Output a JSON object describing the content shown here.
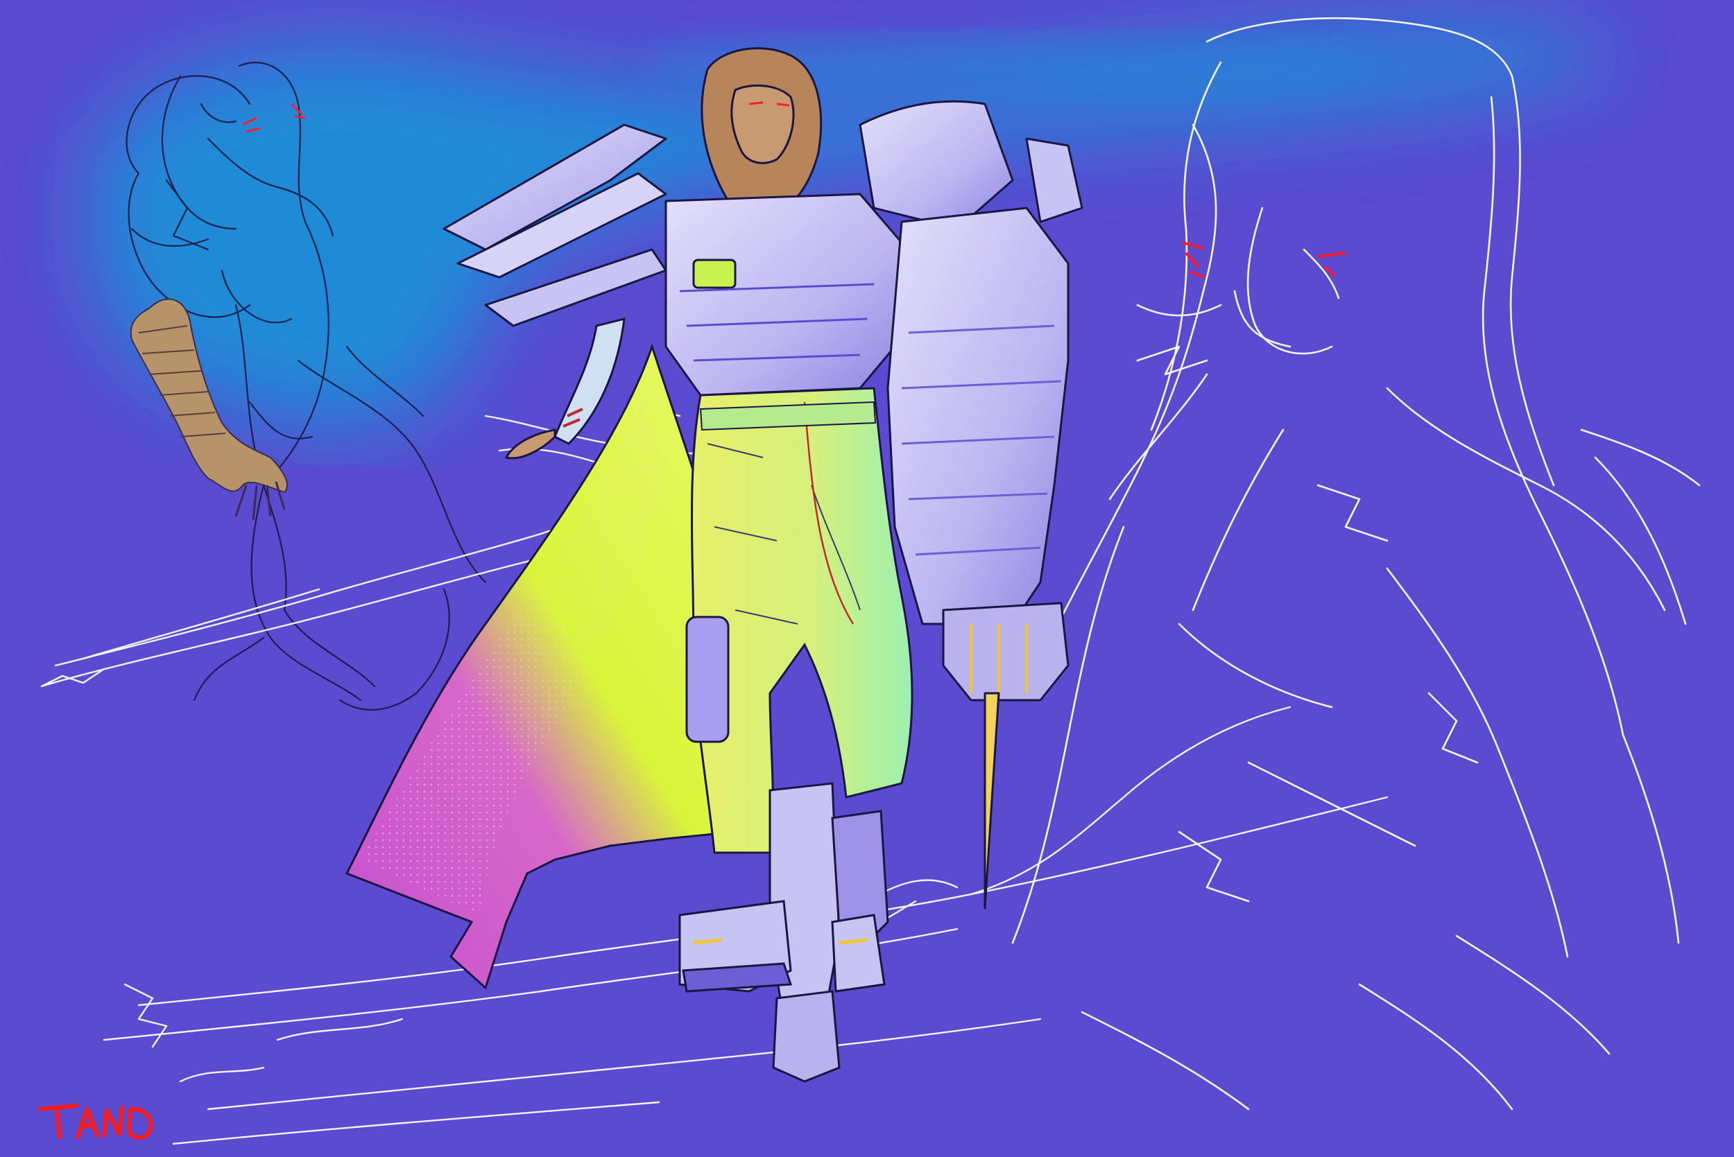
{
  "artwork": {
    "colors": {
      "background": "#5a4bd0",
      "cyan_haze": "#1f8fd8",
      "armor": "#c7c3f2",
      "armor_shadow": "#8a7fe0",
      "pants_yellow": "#e9f277",
      "pants_green": "#a8f0a4",
      "cape_yellow": "#d9f53a",
      "cape_magenta": "#c54fd1",
      "hair": "#b8845a",
      "skin": "#c89a72",
      "sketch_line": "#ffffff",
      "sketch_dark": "#1a1640",
      "eye_red": "#ff1a2a",
      "signature": "#ff1a1a"
    },
    "elements": [
      "cyan-haze",
      "left-sketch-figure",
      "right-sketch-portrait",
      "reclining-sketch-figure",
      "armored-character",
      "signature-mark"
    ]
  }
}
